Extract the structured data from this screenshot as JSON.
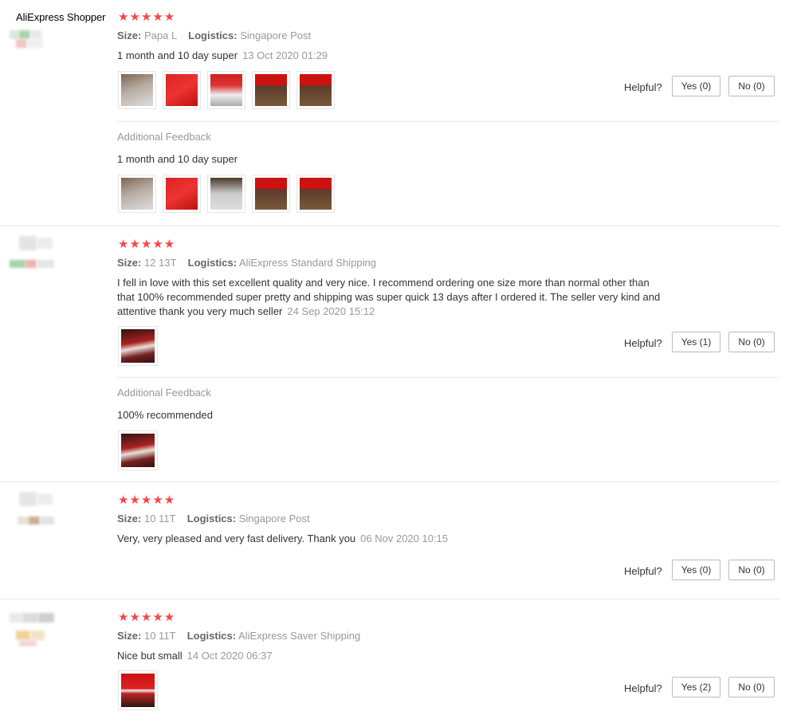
{
  "first_user": "AliExpress Shopper",
  "stars": "★★★★★",
  "labels": {
    "size": "Size:",
    "logistics": "Logistics:",
    "helpful": "Helpful?",
    "additional": "Additional Feedback"
  },
  "reviews": [
    {
      "size": "Papa L",
      "logistics": "Singapore Post",
      "text": "1 month and 10 day super",
      "date": "13 Oct 2020 01:29",
      "yes": "Yes (0)",
      "no": "No (0)",
      "additional_text": "1 month and 10 day super"
    },
    {
      "size": "12 13T",
      "logistics": "AliExpress Standard Shipping",
      "text_lines": [
        "I fell in love with this set excellent quality and very nice. I recommend ordering one size more than normal other than",
        "that 100% recommended super pretty and shipping was super quick 13 days after I ordered it. The seller very kind and",
        "attentive thank you very much seller"
      ],
      "date": "24 Sep 2020 15:12",
      "yes": "Yes (1)",
      "no": "No (0)",
      "additional_text": "100% recommended"
    },
    {
      "size": "10 11T",
      "logistics": "Singapore Post",
      "text": "Very, very pleased and very fast delivery. Thank you",
      "date": "06 Nov 2020 10:15",
      "yes": "Yes (0)",
      "no": "No (0)"
    },
    {
      "size": "10 11T",
      "logistics": "AliExpress Saver Shipping",
      "text": "Nice but small",
      "date": "14 Oct 2020 06:37",
      "yes": "Yes (2)",
      "no": "No (0)"
    }
  ]
}
